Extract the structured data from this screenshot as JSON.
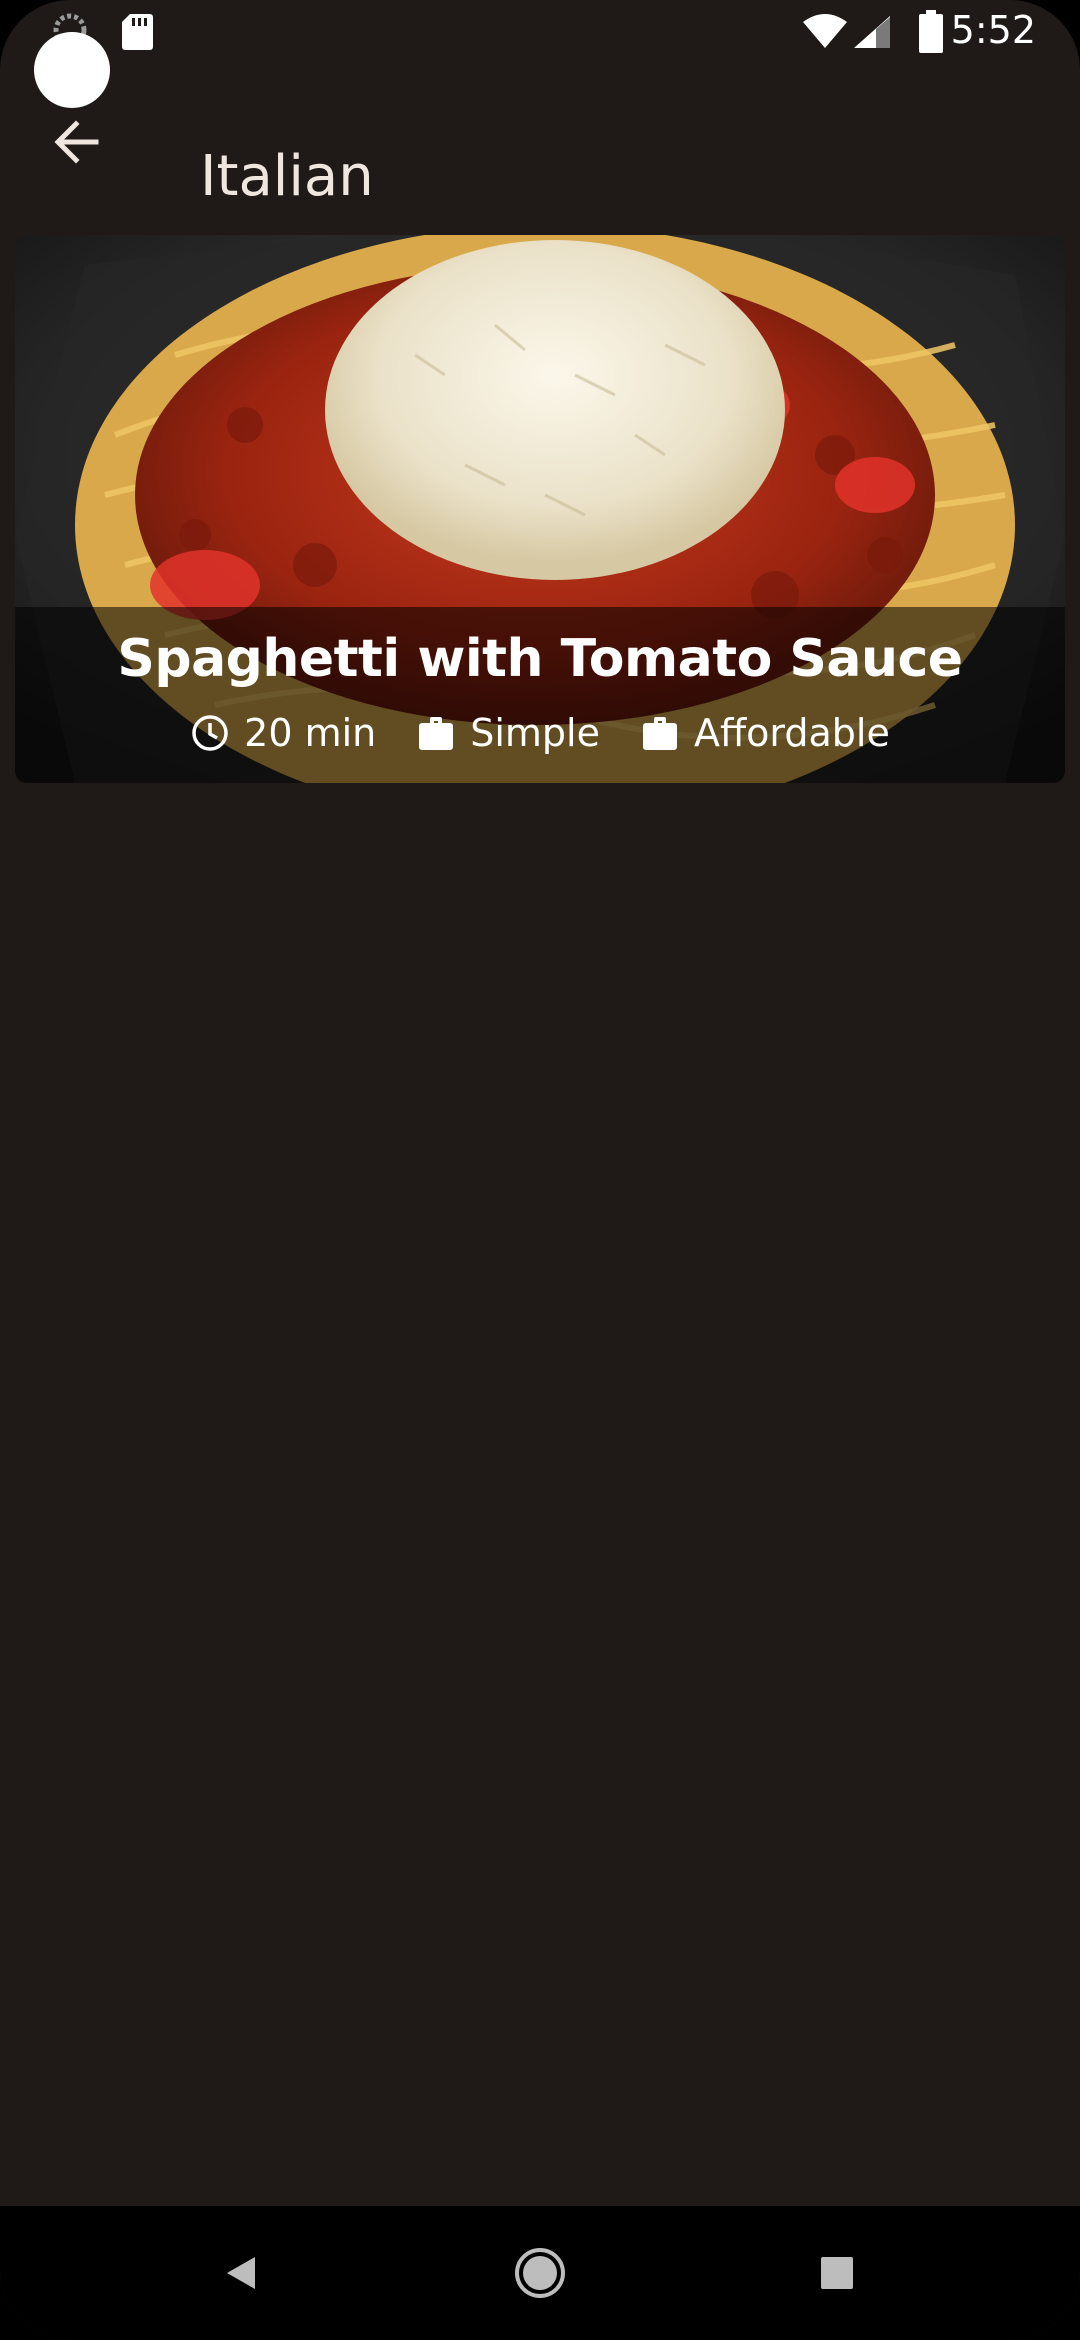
{
  "status_bar": {
    "time": "5:52",
    "icons": [
      "sync-icon",
      "sd-card-icon",
      "wifi-icon",
      "signal-icon",
      "battery-icon"
    ]
  },
  "app_bar": {
    "title": "Italian",
    "back_icon": "arrow-back-icon"
  },
  "meals": [
    {
      "title": "Spaghetti with Tomato Sauce",
      "duration": "20 min",
      "complexity": "Simple",
      "affordability": "Affordable",
      "duration_icon": "clock-icon",
      "complexity_icon": "work-icon",
      "affordability_icon": "work-icon"
    }
  ],
  "nav_bar": {
    "icons": [
      "nav-back-icon",
      "nav-home-icon",
      "nav-recents-icon"
    ]
  },
  "colors": {
    "background": "#1f1a17",
    "title_text": "#f0e6e0",
    "overlay": "rgba(0,0,0,0.55)",
    "nav_bar": "#000000"
  }
}
